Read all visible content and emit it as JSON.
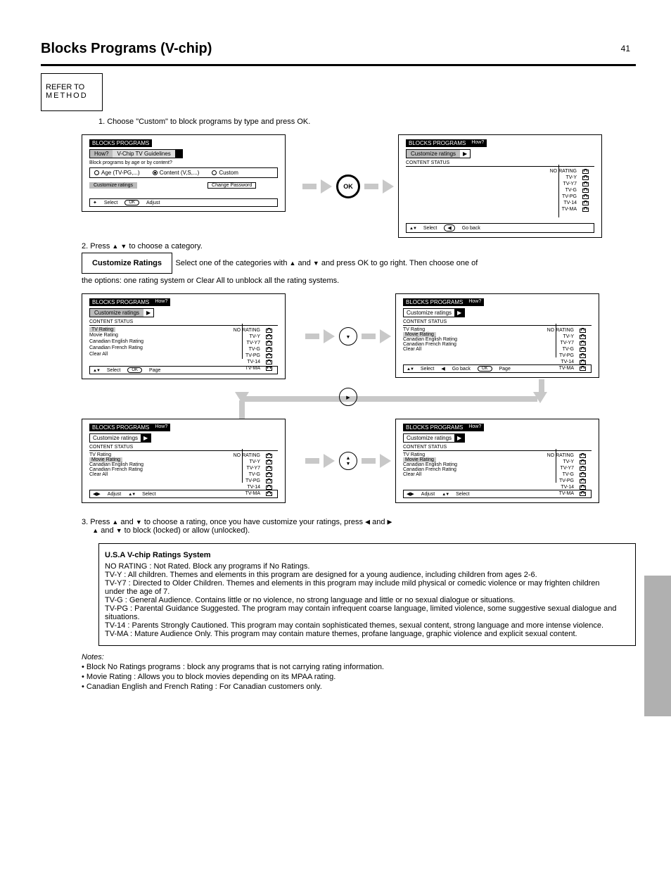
{
  "meta": {
    "page_number": "41",
    "title": "Blocks Programs (V-chip)"
  },
  "method_box": {
    "line1": "REFER TO",
    "line2": "METHOD"
  },
  "step1_text": "Choose \"Custom\" to block programs by type and press OK.",
  "step2_lead": "Press",
  "step2_tail": "to choose a category.",
  "rating_title": "Customize Ratings",
  "rating_help_lead": "Select one of the categories with",
  "rating_help_mid": "and",
  "rating_help_tail": "and press OK to go right. Then choose one of",
  "rating_help_tail2": "the options: one rating system or Clear All to unblock all the rating systems.",
  "step3a": "3. Press",
  "step3b": "and",
  "step3c": "to choose a rating, once you have customize your ratings, press",
  "step3d": "and",
  "step3e": "to block (locked) or allow (unlocked).",
  "tri_left": "◀",
  "tri_right": "▶",
  "tri_up": "▲",
  "tri_down": "▼",
  "screens": {
    "common": {
      "head": "BLOCKS PROGRAMS",
      "sub": "How?",
      "change_pw": "Change Password",
      "col_header": "CONTENT                                    STATUS",
      "hint_select": "Select",
      "hint_adjust": "Adjust",
      "hint_back": "Go back",
      "hint_page": "Page"
    },
    "A": {
      "line": "Block programs by age or by content?",
      "radios": [
        "Age (TV-PG,...)",
        "Content (V,S,...)",
        "Custom"
      ],
      "sub2": "V-Chip TV Guidelines"
    },
    "B": {
      "menu": "Customize ratings",
      "arrow": "▶",
      "rows": [
        "NO RATING",
        "TV-Y",
        "TV-Y7",
        "TV-G",
        "TV-PG",
        "TV-14",
        "TV-MA"
      ]
    },
    "sets": {
      "title_row": "TV RATING",
      "rows": [
        "NO RATING",
        "TV-Y",
        "TV-Y7",
        "TV-G",
        "TV-PG",
        "TV-14",
        "TV-MA"
      ]
    },
    "options": [
      "TV Rating",
      "Movie Rating",
      "Canadian English Rating",
      "Canadian French Rating",
      "Clear All"
    ]
  },
  "explain_box": {
    "heading": "U.S.A V-chip Ratings System",
    "lines": [
      "NO RATING : Not Rated. Block any programs if No Ratings.",
      "TV-Y : All children. Themes and elements in this program are designed for a young audience, including children from ages 2-6.",
      "TV-Y7 : Directed to Older Children. Themes and elements in this program may include mild physical or comedic violence or may frighten children under the age of 7.",
      "TV-G : General Audience. Contains little or no violence, no strong language and little or no sexual dialogue or situations.",
      "TV-PG : Parental Guidance Suggested. The program may contain infrequent coarse language, limited violence, some suggestive sexual dialogue and situations.",
      "TV-14 : Parents Strongly Cautioned. This program may contain sophisticated themes, sexual content, strong language and more intense violence.",
      "TV-MA : Mature Audience Only. This program may contain mature themes, profane language, graphic violence and explicit sexual content."
    ]
  },
  "notes": {
    "heading": "Notes:",
    "items": [
      "Block No Ratings programs : block any programs that is not carrying rating information.",
      "Movie Rating : Allows you to block movies depending on its MPAA rating.",
      "Canadian English and French Rating : For Canadian customers only."
    ]
  }
}
